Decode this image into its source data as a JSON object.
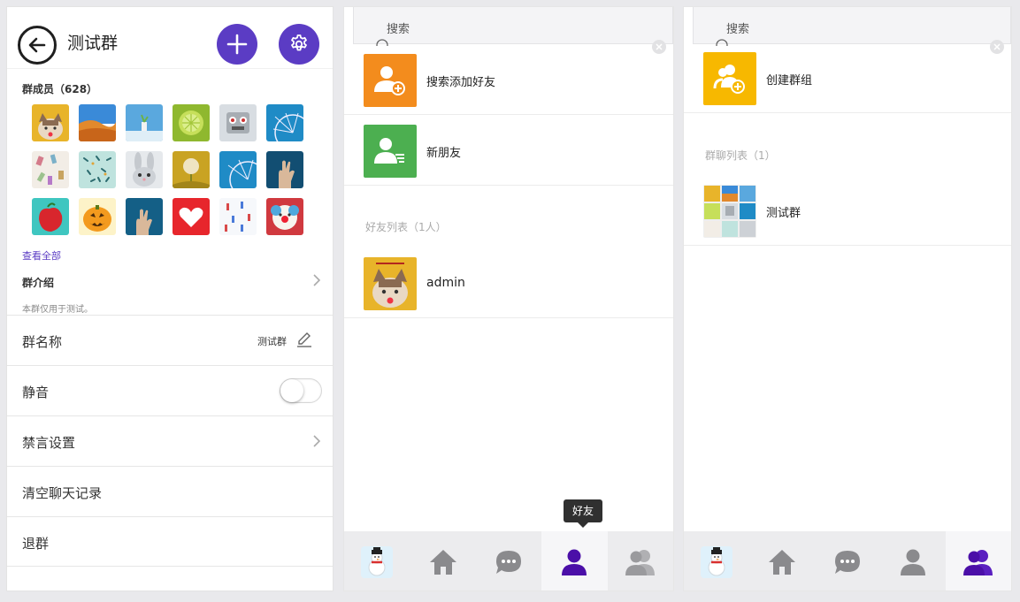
{
  "group_settings": {
    "title": "测试群",
    "members_label": "群成员（628）",
    "view_all": "查看全部",
    "intro_label": "群介绍",
    "intro_text": "本群仅用于测试。",
    "rows": {
      "group_name": {
        "label": "群名称",
        "value": "测试群"
      },
      "mute": {
        "label": "静音",
        "enabled": false
      },
      "ban": {
        "label": "禁言设置"
      },
      "clear": {
        "label": "清空聊天记录"
      },
      "quit": {
        "label": "退群"
      }
    },
    "colors": {
      "accent": "#5b3cc4"
    }
  },
  "friends_panel": {
    "search_placeholder": "搜索",
    "add_friend": "搜索添加好友",
    "new_friend": "新朋友",
    "list_title": "好友列表（1人）",
    "friends": [
      {
        "name": "admin"
      }
    ],
    "tooltip": "好友",
    "colors": {
      "add": "#f38c1d",
      "new": "#4caf50",
      "nav_active": "#4b0fa8"
    }
  },
  "groups_panel": {
    "search_placeholder": "搜索",
    "create_group": "创建群组",
    "list_title": "群聊列表（1）",
    "groups": [
      {
        "name": "测试群"
      }
    ],
    "colors": {
      "create": "#f7b800"
    }
  }
}
